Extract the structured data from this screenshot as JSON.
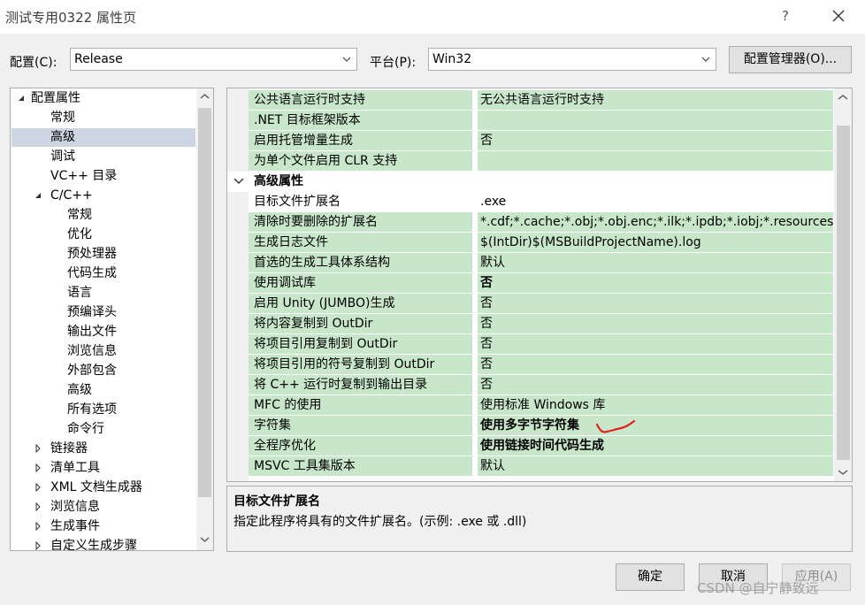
{
  "window": {
    "title": "测试专用0322 属性页",
    "help": "?"
  },
  "config": {
    "label": "配置(C):",
    "value": "Release"
  },
  "platform": {
    "label": "平台(P):",
    "value": "Win32"
  },
  "config_manager_button": "配置管理器(O)...",
  "tree": [
    {
      "label": "配置属性",
      "level": 0,
      "expander": "expanded"
    },
    {
      "label": "常规",
      "level": 1
    },
    {
      "label": "高级",
      "level": 1,
      "selected": true
    },
    {
      "label": "调试",
      "level": 1
    },
    {
      "label": "VC++ 目录",
      "level": 1
    },
    {
      "label": "C/C++",
      "level": 1,
      "expander": "expanded"
    },
    {
      "label": "常规",
      "level": 2
    },
    {
      "label": "优化",
      "level": 2
    },
    {
      "label": "预处理器",
      "level": 2
    },
    {
      "label": "代码生成",
      "level": 2
    },
    {
      "label": "语言",
      "level": 2
    },
    {
      "label": "预编译头",
      "level": 2
    },
    {
      "label": "输出文件",
      "level": 2
    },
    {
      "label": "浏览信息",
      "level": 2
    },
    {
      "label": "外部包含",
      "level": 2
    },
    {
      "label": "高级",
      "level": 2
    },
    {
      "label": "所有选项",
      "level": 2
    },
    {
      "label": "命令行",
      "level": 2
    },
    {
      "label": "链接器",
      "level": 1,
      "expander": "collapsed"
    },
    {
      "label": "清单工具",
      "level": 1,
      "expander": "collapsed"
    },
    {
      "label": "XML 文档生成器",
      "level": 1,
      "expander": "collapsed"
    },
    {
      "label": "浏览信息",
      "level": 1,
      "expander": "collapsed"
    },
    {
      "label": "生成事件",
      "level": 1,
      "expander": "collapsed"
    },
    {
      "label": "自定义生成步骤",
      "level": 1,
      "expander": "collapsed"
    }
  ],
  "grid": {
    "rows_top": [
      {
        "name": "公共语言运行时支持",
        "value": "无公共语言运行时支持"
      },
      {
        "name": ".NET 目标框架版本",
        "value": ""
      },
      {
        "name": "启用托管增量生成",
        "value": "否"
      },
      {
        "name": "为单个文件启用 CLR 支持",
        "value": ""
      }
    ],
    "category": "高级属性",
    "rows": [
      {
        "name": "目标文件扩展名",
        "value": ".exe",
        "selected": true
      },
      {
        "name": "清除时要删除的扩展名",
        "value": "*.cdf;*.cache;*.obj;*.obj.enc;*.ilk;*.ipdb;*.iobj;*.resources"
      },
      {
        "name": "生成日志文件",
        "value": "$(IntDir)$(MSBuildProjectName).log"
      },
      {
        "name": "首选的生成工具体系结构",
        "value": "默认"
      },
      {
        "name": "使用调试库",
        "value": "否",
        "bold": true
      },
      {
        "name": "启用 Unity (JUMBO)生成",
        "value": "否"
      },
      {
        "name": "将内容复制到 OutDir",
        "value": "否"
      },
      {
        "name": "将项目引用复制到 OutDir",
        "value": "否"
      },
      {
        "name": "将项目引用的符号复制到 OutDir",
        "value": "否"
      },
      {
        "name": "将 C++ 运行时复制到输出目录",
        "value": "否"
      },
      {
        "name": "MFC 的使用",
        "value": "使用标准 Windows 库"
      },
      {
        "name": "字符集",
        "value": "使用多字节字符集",
        "bold": true
      },
      {
        "name": "全程序优化",
        "value": "使用链接时间代码生成",
        "bold": true
      },
      {
        "name": "MSVC 工具集版本",
        "value": "默认"
      }
    ]
  },
  "description": {
    "title": "目标文件扩展名",
    "text": "指定此程序将具有的文件扩展名。(示例: .exe 或 .dll)"
  },
  "buttons": {
    "ok": "确定",
    "cancel": "取消",
    "apply": "应用(A)"
  },
  "watermark": "CSDN @自宁静致远",
  "icons": [
    "close-icon",
    "chevron-down-icon",
    "chevron-up-icon",
    "expand-arrow-icon",
    "collapse-arrow-icon"
  ],
  "colors": {
    "property_bg": "#c8e6c9",
    "selected_tree_bg": "#cdd4e2",
    "annotation": "#e02020"
  }
}
